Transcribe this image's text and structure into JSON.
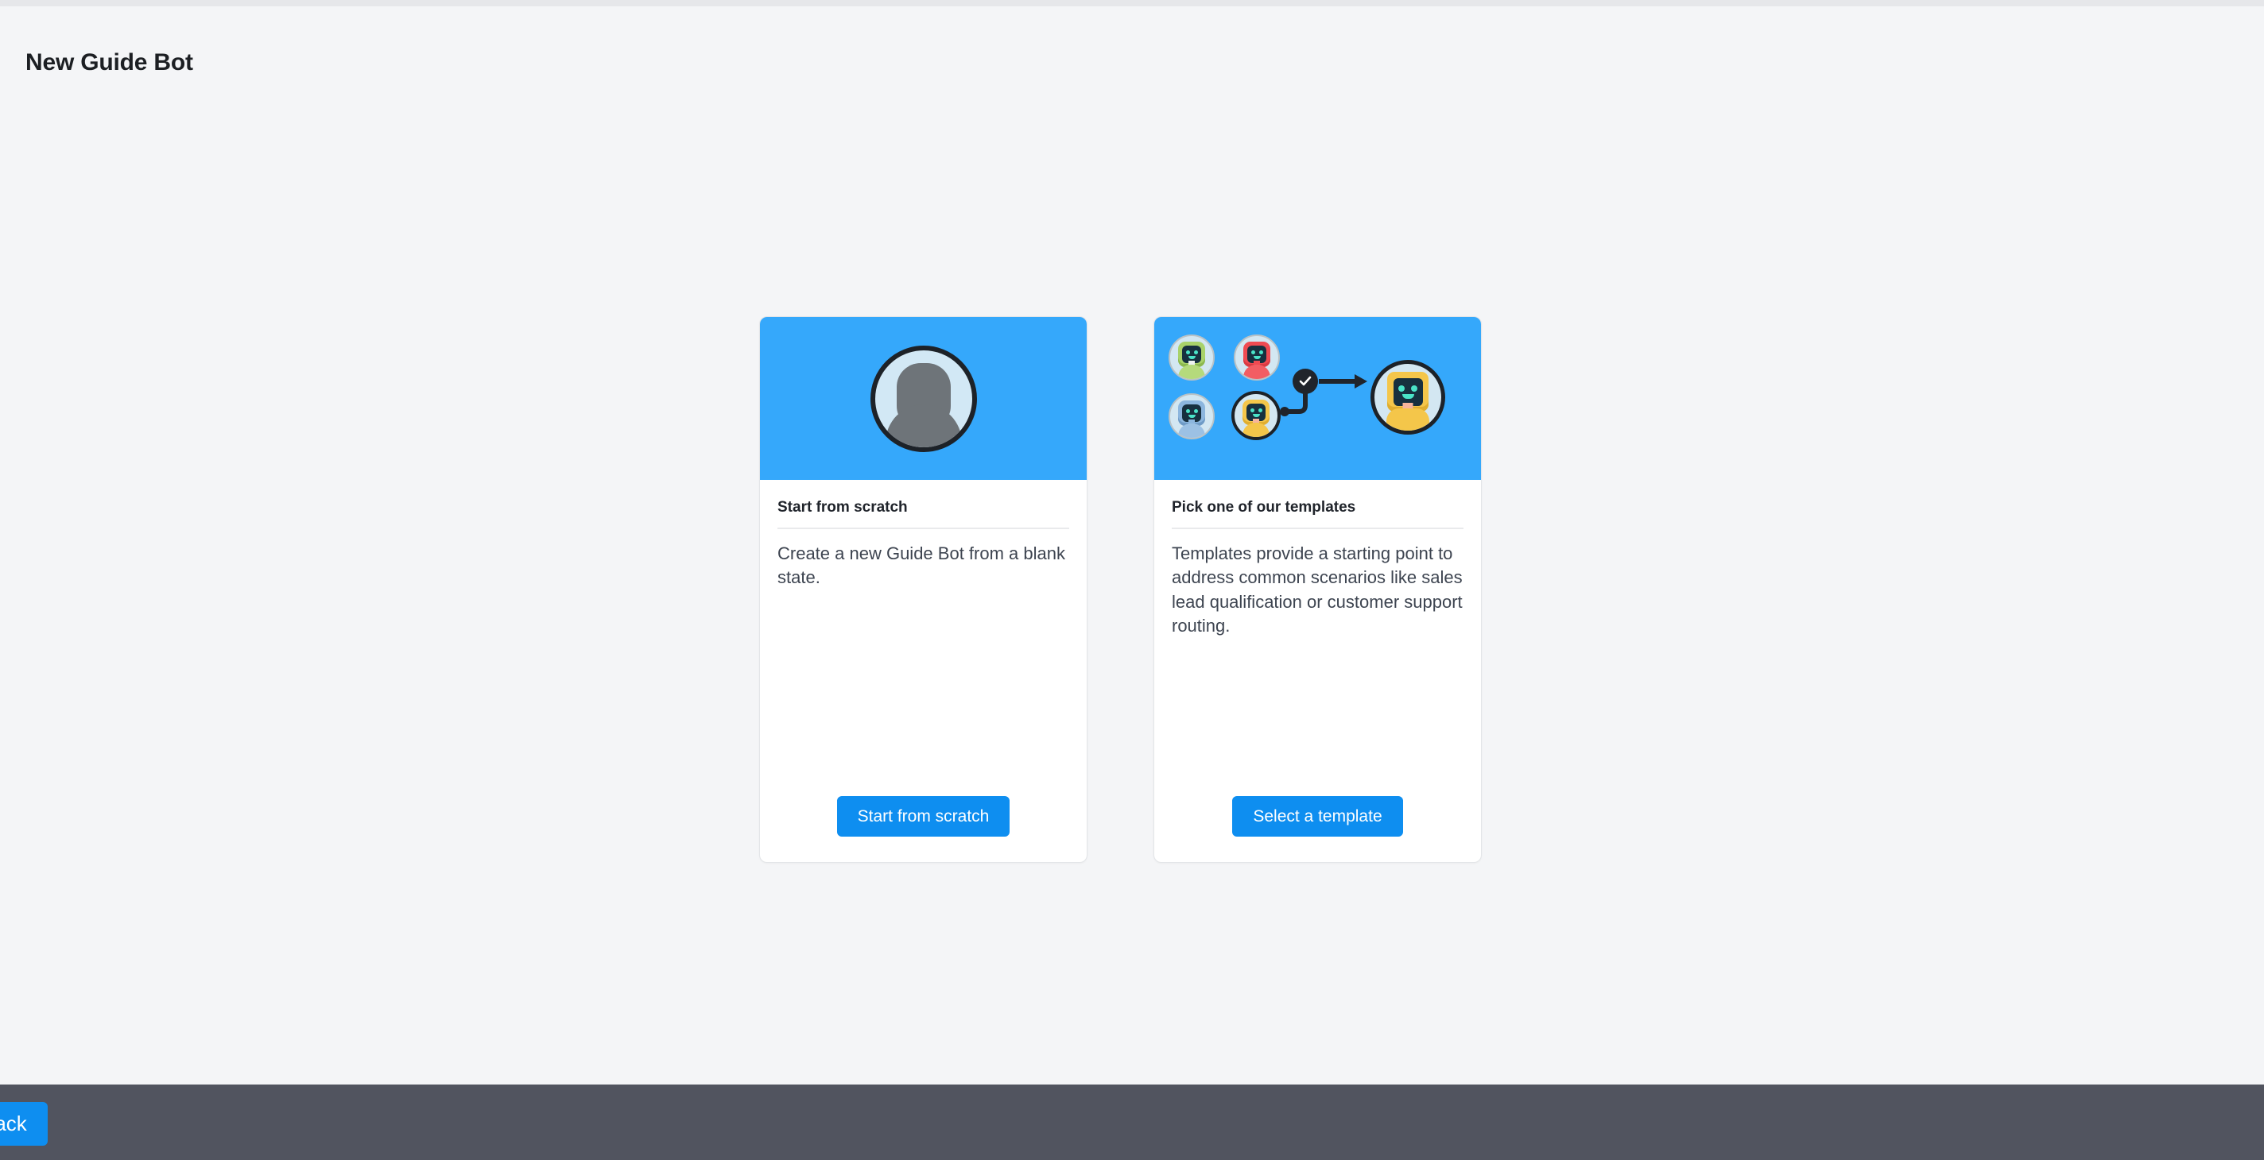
{
  "page": {
    "title": "New Guide Bot",
    "background_color": "#f4f5f7"
  },
  "colors": {
    "accent_blue": "#0e8ef0",
    "card_header_blue": "#35a8fb",
    "footer_gray": "#51545f",
    "heading_text": "#20242b",
    "body_text": "#3d4450"
  },
  "cards": [
    {
      "id": "start-from-scratch",
      "illustration": "person-avatar-icon",
      "heading": "Start from scratch",
      "description": "Create a new Guide Bot from a blank state.",
      "button_label": "Start from scratch"
    },
    {
      "id": "pick-template",
      "illustration": "robot-templates-icon",
      "heading": "Pick one of our templates",
      "description": "Templates provide a starting point to address common scenarios like sales lead qualification or customer support routing.",
      "button_label": "Select a template"
    }
  ],
  "illustration_bots": [
    {
      "name": "green-bot",
      "color": "#a8d26a",
      "color_dark": "#8cb84f",
      "selected": false
    },
    {
      "name": "red-bot",
      "color": "#ef4a52",
      "color_dark": "#d93a43",
      "selected": false
    },
    {
      "name": "blue-bot",
      "color": "#8cb6de",
      "color_dark": "#6f9bc6",
      "selected": false
    },
    {
      "name": "yellow-bot",
      "color": "#f4c64a",
      "color_dark": "#e0ae2f",
      "selected": true
    },
    {
      "name": "yellow-bot-large",
      "color": "#f4c64a",
      "color_dark": "#e0ae2f",
      "selected": true
    }
  ],
  "footer": {
    "back_label": "Back"
  }
}
